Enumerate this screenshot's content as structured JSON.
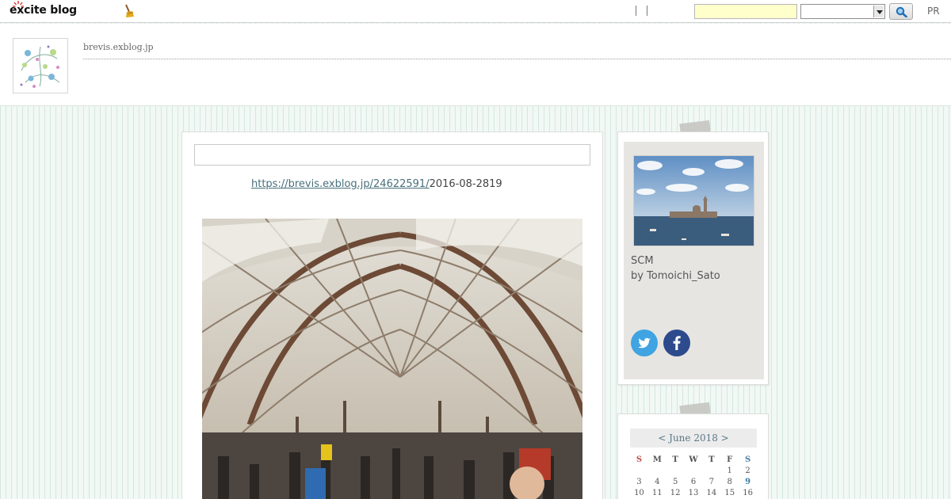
{
  "topbar": {
    "logo_text": "excite blog",
    "search_placeholder": "",
    "search_select_value": "",
    "pr_label": "PR"
  },
  "header": {
    "blog_domain": "brevis.exblog.jp"
  },
  "post": {
    "title": "",
    "link_text": "https://brevis.exblog.jp/24622591/",
    "date_text": "2016-08-2819"
  },
  "profile": {
    "blog_name": "SCM",
    "author_line": "by Tomoichi_Sato"
  },
  "calendar": {
    "header": "< June 2018 >",
    "weekdays": [
      "S",
      "M",
      "T",
      "W",
      "T",
      "F",
      "S"
    ],
    "rows": [
      [
        "",
        "",
        "",
        "",
        "",
        "1",
        "2"
      ],
      [
        "3",
        "4",
        "5",
        "6",
        "7",
        "8",
        "9"
      ],
      [
        "10",
        "11",
        "12",
        "13",
        "14",
        "15",
        "16"
      ]
    ],
    "linked_days": [
      "9"
    ]
  },
  "colors": {
    "link": "#48707b",
    "twitter": "#40a3e2",
    "facebook": "#2d4a8c",
    "search_input_bg": "#ffffcc",
    "page_bg": "#f2f8f5"
  },
  "icons": {
    "logo": "excite-logo-icon",
    "broom": "broom-icon",
    "search": "magnifier-icon",
    "twitter": "twitter-icon",
    "facebook": "facebook-icon"
  }
}
